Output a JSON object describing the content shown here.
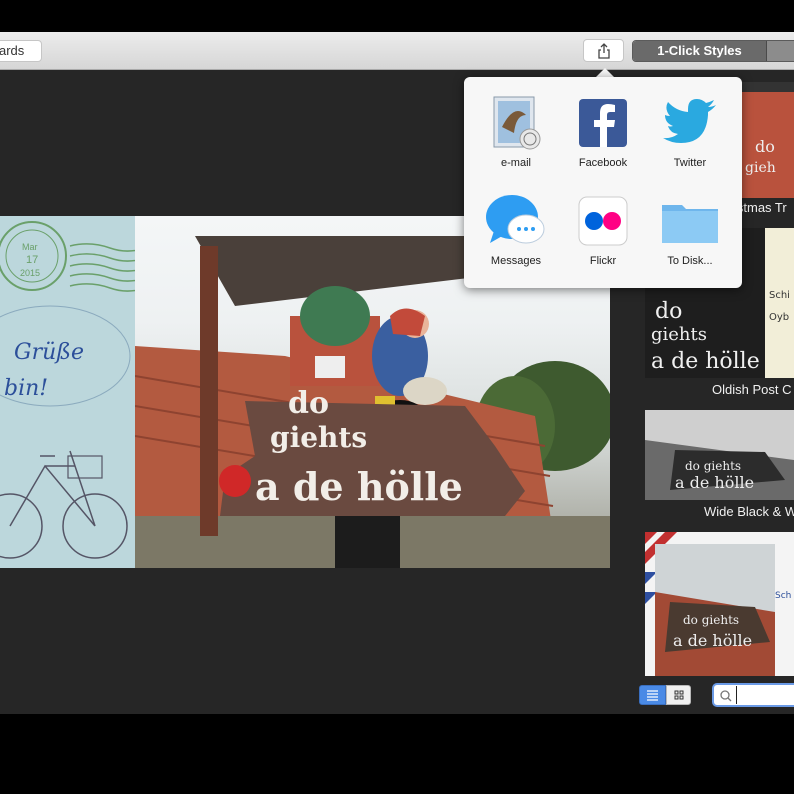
{
  "toolbar": {
    "postcards_label": "ards",
    "share_tooltip": "",
    "styles_segment_label": "1-Click Styles"
  },
  "share_menu": {
    "items": [
      {
        "label": "e-mail",
        "icon": "mail-icon"
      },
      {
        "label": "Facebook",
        "icon": "facebook-icon"
      },
      {
        "label": "Twitter",
        "icon": "twitter-icon"
      },
      {
        "label": "Messages",
        "icon": "messages-icon"
      },
      {
        "label": "Flickr",
        "icon": "flickr-icon"
      },
      {
        "label": "To Disk...",
        "icon": "folder-icon"
      }
    ]
  },
  "postcard": {
    "stamp_postmark": [
      "Mar",
      "17",
      "2015"
    ],
    "greeting_lines": [
      "Grüße",
      "bin!"
    ],
    "sign_lines": [
      "do",
      "giehts",
      "a de hölle"
    ]
  },
  "styles": {
    "thumbnails": [
      {
        "label": "istmas Tr"
      },
      {
        "label": "Oldish Post C"
      },
      {
        "label": "Wide Black & W"
      },
      {
        "label": ""
      }
    ]
  },
  "bottom": {
    "search_placeholder": ""
  },
  "colors": {
    "accent": "#4a8ae6",
    "workspace": "#262626",
    "facebook": "#3b5998",
    "twitter": "#1da1f2",
    "flickr_blue": "#0063dc",
    "flickr_pink": "#ff0084"
  }
}
